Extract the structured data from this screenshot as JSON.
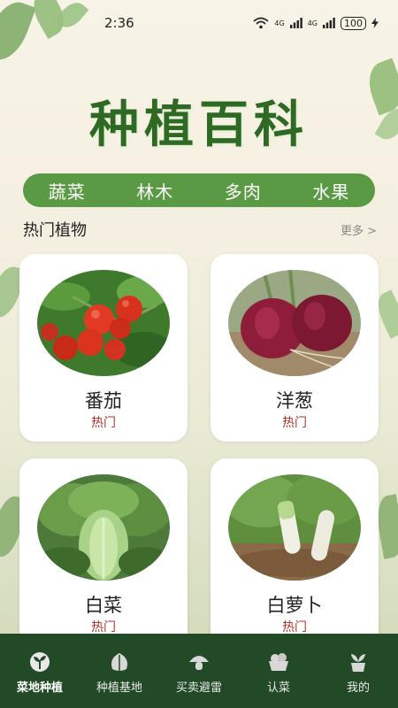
{
  "status_bar": {
    "time": "2:36",
    "signal_1": "4G",
    "signal_2": "4G",
    "battery": "100"
  },
  "page_title": "种植百科",
  "categories": [
    "蔬菜",
    "林木",
    "多肉",
    "水果"
  ],
  "section": {
    "title": "热门植物",
    "more_label": "更多 >"
  },
  "plants": [
    {
      "name": "番茄",
      "tag": "热门",
      "image": "tomato"
    },
    {
      "name": "洋葱",
      "tag": "热门",
      "image": "onion"
    },
    {
      "name": "白菜",
      "tag": "热门",
      "image": "cabbage"
    },
    {
      "name": "白萝卜",
      "tag": "热门",
      "image": "radish"
    }
  ],
  "bottom_nav": [
    {
      "label": "菜地种植",
      "icon": "sprout-icon",
      "active": true
    },
    {
      "label": "种植基地",
      "icon": "leaf-icon",
      "active": false
    },
    {
      "label": "买卖避雷",
      "icon": "mushroom-icon",
      "active": false
    },
    {
      "label": "认菜",
      "icon": "vegetable-basket-icon",
      "active": false
    },
    {
      "label": "我的",
      "icon": "plant-pot-icon",
      "active": false
    }
  ],
  "colors": {
    "brand_green": "#2e6a24",
    "category_bar": "#5b9a45",
    "nav_background": "#224a27",
    "tag_red": "#b0302a"
  }
}
